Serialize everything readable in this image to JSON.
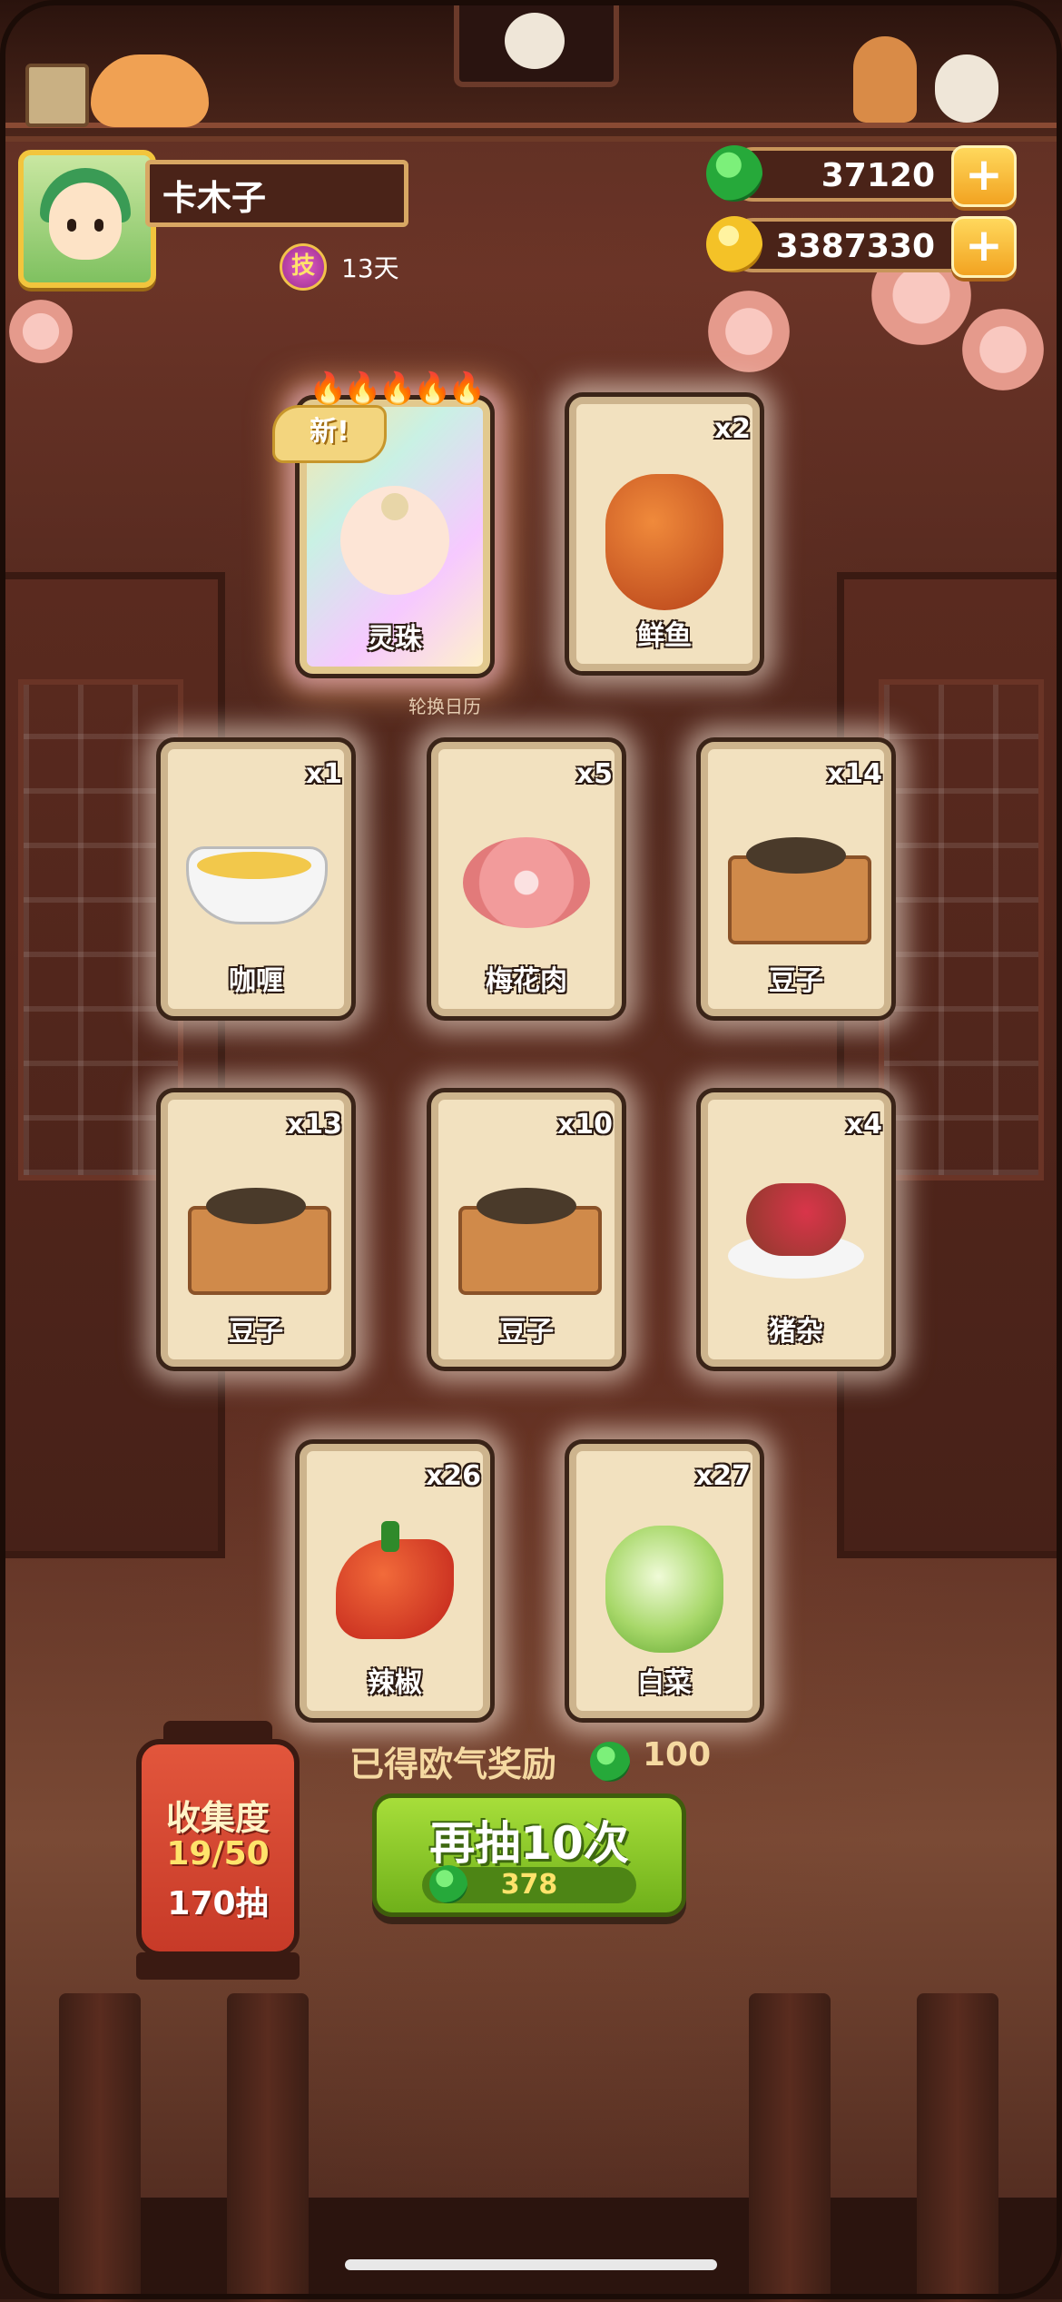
{
  "player": {
    "name": "卡木子",
    "skill_badge": "技",
    "days": "13天"
  },
  "currency": {
    "jade": "37120",
    "coins": "3387330",
    "add_label": "+"
  },
  "cards": [
    {
      "name": "灵珠",
      "count": "",
      "is_new": true,
      "new_label": "新!",
      "icon": "character-lingzhu-icon"
    },
    {
      "name": "鲜鱼",
      "count": "x2",
      "icon": "fish-icon"
    },
    {
      "name": "咖喱",
      "count": "x1",
      "icon": "curry-gravy-boat-icon"
    },
    {
      "name": "梅花肉",
      "count": "x5",
      "icon": "pork-meat-icon"
    },
    {
      "name": "豆子",
      "count": "x14",
      "icon": "beans-box-icon"
    },
    {
      "name": "豆子",
      "count": "x13",
      "icon": "beans-box-icon"
    },
    {
      "name": "豆子",
      "count": "x10",
      "icon": "beans-box-icon"
    },
    {
      "name": "猪杂",
      "count": "x4",
      "icon": "pork-offal-icon"
    },
    {
      "name": "辣椒",
      "count": "x26",
      "icon": "chili-pepper-icon"
    },
    {
      "name": "白菜",
      "count": "x27",
      "icon": "cabbage-icon"
    }
  ],
  "calendar_label": "轮换日历",
  "reward": {
    "label": "已得欧气奖励",
    "value": "100"
  },
  "draw": {
    "label": "再抽10次",
    "cost": "378"
  },
  "collection": {
    "title": "收集度",
    "progress": "19/50",
    "pulls": "170抽"
  }
}
